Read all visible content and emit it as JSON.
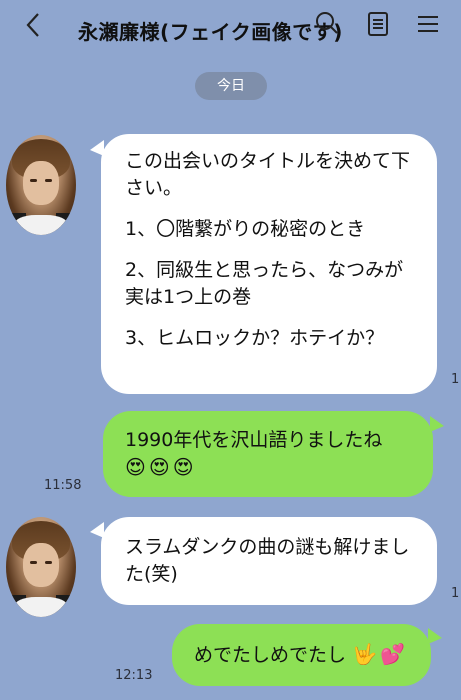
{
  "header": {
    "title": "永瀬廉様(フェイク画像です)"
  },
  "date_badge": "今日",
  "messages": {
    "m1": {
      "p1": "この出会いのタイトルを決めて下さい。",
      "p2": "1、〇階繋がりの秘密のとき",
      "p3": "2、同級生と思ったら、なつみが実は1つ上の巻",
      "p4": "3、ヒムロックか？ホテイか？",
      "time_partial": "1"
    },
    "m2": {
      "text": "1990年代を沢山語りましたね",
      "emoji": "😍😍😍",
      "time": "11:58"
    },
    "m3": {
      "text": "スラムダンクの曲の謎も解けました(笑)",
      "time_partial": "1"
    },
    "m4": {
      "text": "めでたしめでたし",
      "emoji": "🤟💕",
      "time": "12:13"
    }
  },
  "icons": [
    "back-icon",
    "search-icon",
    "notes-icon",
    "menu-icon"
  ]
}
